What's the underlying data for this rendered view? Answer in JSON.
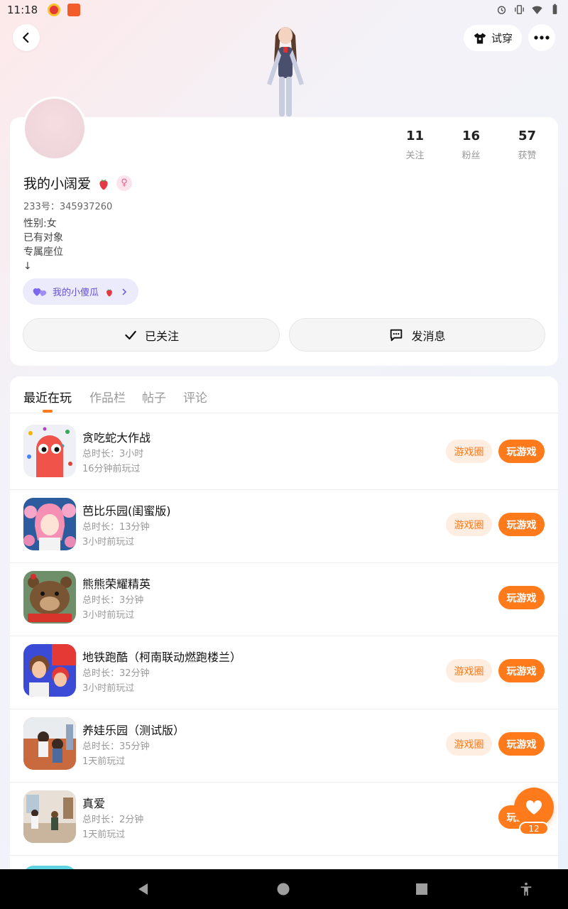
{
  "status_bar": {
    "time": "11:18"
  },
  "header": {
    "tryon_label": "试穿"
  },
  "profile": {
    "name": "我的小阔爱",
    "uid": "233号：345937260",
    "bio": [
      "性别:女",
      "已有对象",
      "专属座位",
      "↓"
    ],
    "cp_tag": "我的小傻瓜",
    "stats": [
      {
        "num": "11",
        "label": "关注"
      },
      {
        "num": "16",
        "label": "粉丝"
      },
      {
        "num": "57",
        "label": "获赞"
      }
    ],
    "follow_label": "已关注",
    "message_label": "发消息"
  },
  "tabs": [
    "最近在玩",
    "作品栏",
    "帖子",
    "评论"
  ],
  "games": [
    {
      "title": "贪吃蛇大作战",
      "duration": "总时长：3小时",
      "last": "16分钟前玩过",
      "has_circle": true
    },
    {
      "title": "芭比乐园(闺蜜版)",
      "duration": "总时长：13分钟",
      "last": "3小时前玩过",
      "has_circle": true
    },
    {
      "title": "熊熊荣耀精英",
      "duration": "总时长：3分钟",
      "last": "3小时前玩过",
      "has_circle": false
    },
    {
      "title": "地铁跑酷（柯南联动燃跑楼兰）",
      "duration": "总时长：32分钟",
      "last": "3小时前玩过",
      "has_circle": true
    },
    {
      "title": "养娃乐园（测试版）",
      "duration": "总时长：35分钟",
      "last": "1天前玩过",
      "has_circle": true
    },
    {
      "title": "真爱",
      "duration": "总时长：2分钟",
      "last": "1天前玩过",
      "has_circle": false
    }
  ],
  "buttons": {
    "circle": "游戏圈",
    "play": "玩游戏"
  },
  "fab": {
    "count": "12"
  },
  "colors": {
    "accent": "#ff7a1a",
    "accent_light": "#feeee2",
    "tag_purple": "#6452d8"
  }
}
